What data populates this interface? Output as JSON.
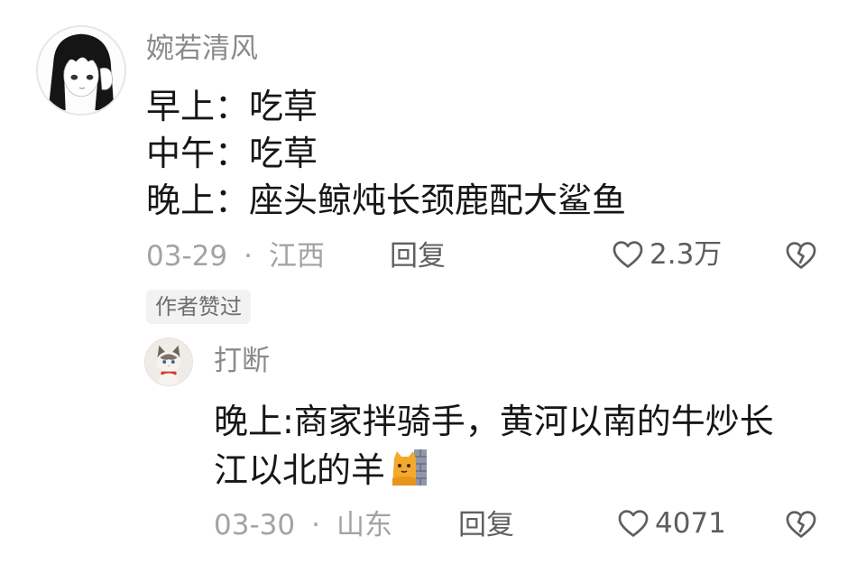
{
  "main_comment": {
    "username": "婉若清风",
    "lines": [
      "早上：吃草",
      "中午：吃草",
      "晚上：座头鲸炖长颈鹿配大鲨鱼"
    ],
    "date": "03-29",
    "separator": "·",
    "location": "江西",
    "reply_label": "回复",
    "like_count": "2.3万",
    "author_liked_badge": "作者赞过"
  },
  "reply_comment": {
    "username": "打断",
    "lines": [
      "晚上:商家拌骑手，黄河以南的牛炒长",
      "江以北的羊"
    ],
    "date": "03-30",
    "separator": "·",
    "location": "山东",
    "reply_label": "回复",
    "like_count": "4071"
  },
  "colors": {
    "username": "#8a8a8a",
    "body_text": "#161616",
    "meta_text": "#a3a3a3",
    "reply_text": "#606060",
    "badge_bg": "#f2f2f2"
  },
  "icons": {
    "like": "heart-outline-icon",
    "dislike": "broken-heart-icon",
    "emoji": "cat-peeking-wall-emoji"
  }
}
